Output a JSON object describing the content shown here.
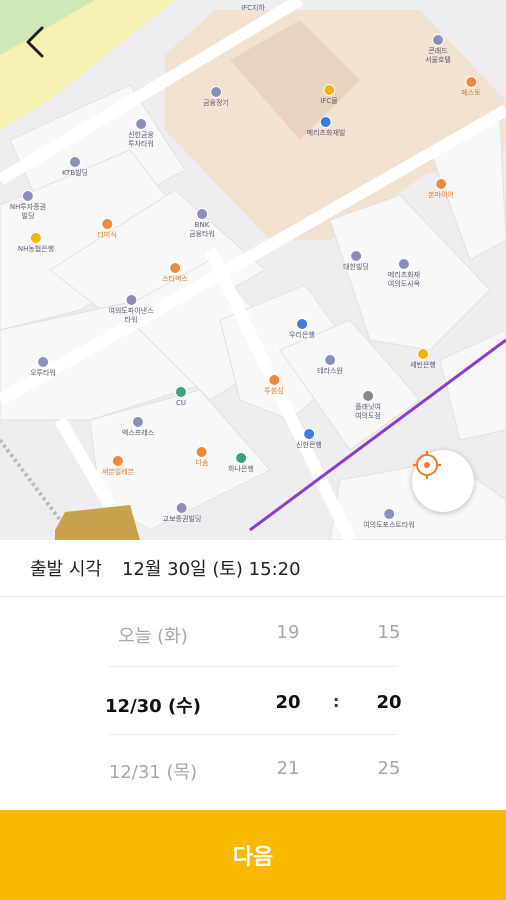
{
  "map": {
    "pois": [
      {
        "label": "IFC지하",
        "style": ""
      },
      {
        "label": "콘래드\n서울호텔",
        "style": ""
      },
      {
        "label": "페스토",
        "style": "orange"
      },
      {
        "label": "금융정기",
        "style": ""
      },
      {
        "label": "IFC몰",
        "style": "yellow"
      },
      {
        "label": "메리츠화재빌",
        "style": "blue"
      },
      {
        "label": "신한금융\n투자타워",
        "style": ""
      },
      {
        "label": "KTB빌딩",
        "style": ""
      },
      {
        "label": "NH투자증권\n빌딩",
        "style": ""
      },
      {
        "label": "NH농협은행",
        "style": "yellow"
      },
      {
        "label": "더미식",
        "style": "orange"
      },
      {
        "label": "BNK\n금융타워",
        "style": ""
      },
      {
        "label": "스타벅스",
        "style": "orange"
      },
      {
        "label": "여의도파이낸스\n타워",
        "style": ""
      },
      {
        "label": "오투타워",
        "style": ""
      },
      {
        "label": "우리은행",
        "style": "blue"
      },
      {
        "label": "투썸섬",
        "style": "orange"
      },
      {
        "label": "테라스원",
        "style": ""
      },
      {
        "label": "CU",
        "style": "green"
      },
      {
        "label": "엑스프레스",
        "style": ""
      },
      {
        "label": "다솜",
        "style": "orange"
      },
      {
        "label": "하나은행",
        "style": "green"
      },
      {
        "label": "신한은행",
        "style": "blue"
      },
      {
        "label": "세븐일레븐",
        "style": "orange"
      },
      {
        "label": "교보증권빌딩",
        "style": ""
      },
      {
        "label": "대한빌딩",
        "style": ""
      },
      {
        "label": "메리츠화재\n여의도사옥",
        "style": ""
      },
      {
        "label": "본마이어",
        "style": "orange"
      },
      {
        "label": "세빈은행",
        "style": "yellow"
      },
      {
        "label": "플래닛여\n여의도점",
        "style": "gray"
      },
      {
        "label": "여의도포스트타워",
        "style": ""
      }
    ]
  },
  "departure": {
    "label": "출발 시각",
    "value": "12월 30일 (토) 15:20"
  },
  "picker": {
    "rows": [
      {
        "date": "오늘 (화)",
        "hour": "19",
        "minute": "15"
      },
      {
        "date": "12/30 (수)",
        "hour": "20",
        "minute": "20"
      },
      {
        "date": "12/31 (목)",
        "hour": "21",
        "minute": "25"
      }
    ],
    "separator": ":"
  },
  "next_button": "다음",
  "colors": {
    "accent": "#f9b900",
    "route": "#8a3ccf",
    "park": "#f6f2b3",
    "ifc_block": "#f2e2d2"
  }
}
